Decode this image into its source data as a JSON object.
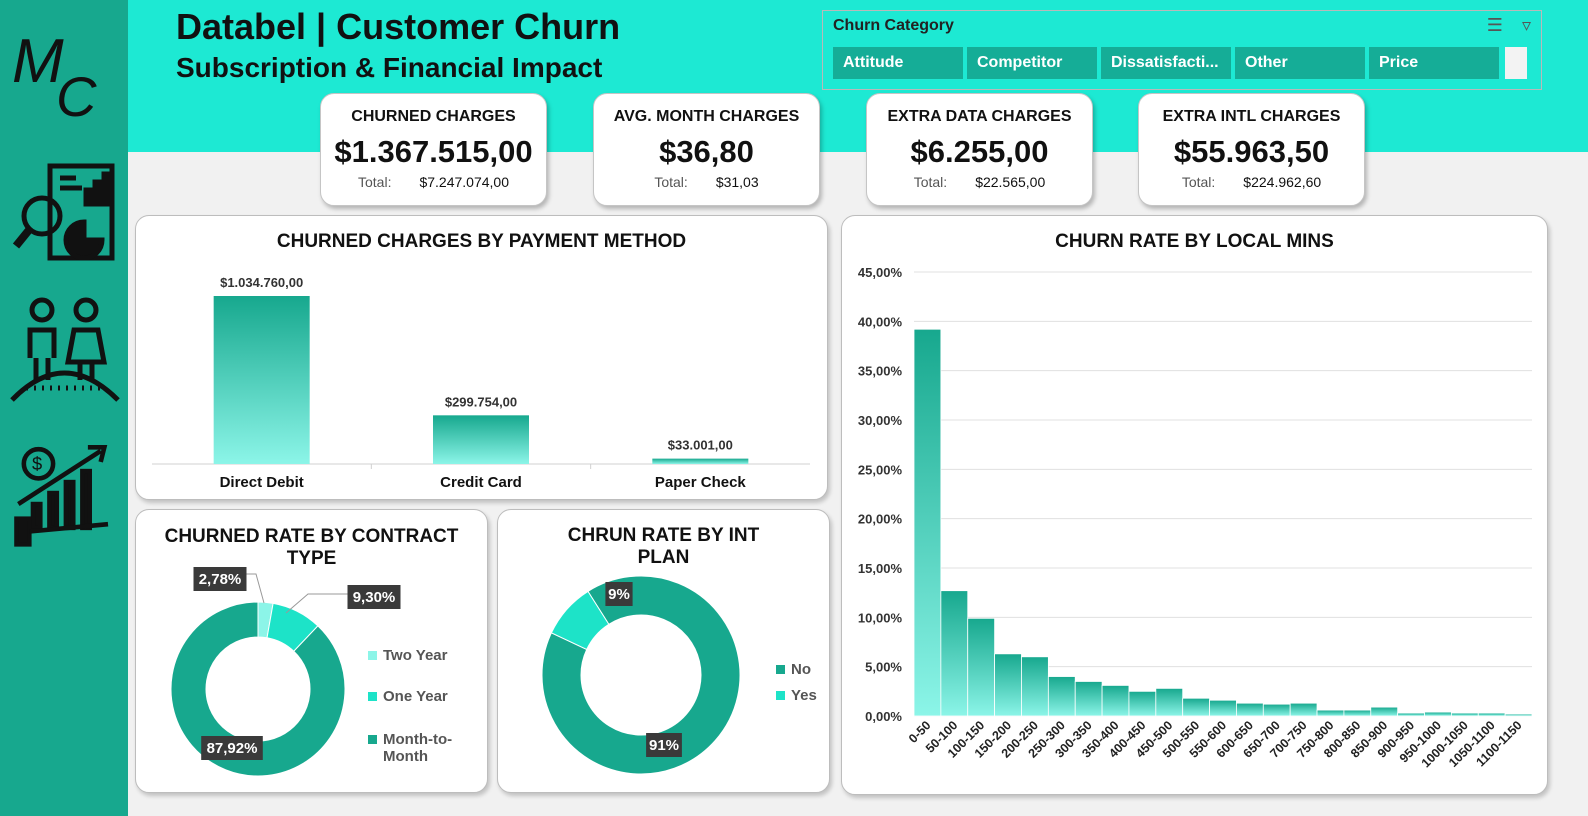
{
  "header": {
    "title": "Databel | Customer Churn",
    "subtitle": "Subscription & Financial Impact",
    "logo_text": "MC"
  },
  "sidebar": {
    "icons": [
      "report-analysis-icon",
      "customers-icon",
      "financial-growth-icon"
    ]
  },
  "slicer": {
    "title": "Churn Category",
    "items": [
      "Attitude",
      "Competitor",
      "Dissatisfacti...",
      "Other",
      "Price"
    ]
  },
  "kpis": [
    {
      "label": "CHURNED CHARGES",
      "value": "$1.367.515,00",
      "total_label": "Total:",
      "total_value": "$7.247.074,00"
    },
    {
      "label": "AVG. MONTH CHARGES",
      "value": "$36,80",
      "total_label": "Total:",
      "total_value": "$31,03"
    },
    {
      "label": "EXTRA DATA CHARGES",
      "value": "$6.255,00",
      "total_label": "Total:",
      "total_value": "$22.565,00"
    },
    {
      "label": "EXTRA INTL CHARGES",
      "value": "$55.963,50",
      "total_label": "Total:",
      "total_value": "$224.962,60"
    }
  ],
  "colors": {
    "accent": "#1de9d3",
    "sidebar": "#17a88e",
    "dark_teal": "#17a88e",
    "mid_teal": "#1de3c8",
    "light_teal": "#8cf5e8"
  },
  "chart_data": [
    {
      "type": "bar",
      "title": "CHURNED CHARGES BY PAYMENT METHOD",
      "categories": [
        "Direct Debit",
        "Credit Card",
        "Paper Check"
      ],
      "values": [
        1034760.0,
        299754.0,
        33001.0
      ],
      "data_labels": [
        "$1.034.760,00",
        "$299.754,00",
        "$33.001,00"
      ]
    },
    {
      "type": "pie",
      "title": "CHURNED RATE BY CONTRACT TYPE",
      "categories": [
        "Two Year",
        "One Year",
        "Month-to-Month"
      ],
      "values": [
        2.78,
        9.3,
        87.92
      ],
      "data_labels": [
        "2,78%",
        "9,30%",
        "87,92%"
      ],
      "legend": "right"
    },
    {
      "type": "pie",
      "title": "CHRUN RATE BY INT PLAN",
      "categories": [
        "No",
        "Yes"
      ],
      "values": [
        91,
        9
      ],
      "data_labels": [
        "91%",
        "9%"
      ],
      "legend": "right"
    },
    {
      "type": "bar",
      "title": "CHURN RATE BY LOCAL MINS",
      "categories": [
        "0-50",
        "50-100",
        "100-150",
        "150-200",
        "200-250",
        "250-300",
        "300-350",
        "350-400",
        "400-450",
        "450-500",
        "500-550",
        "550-600",
        "600-650",
        "650-700",
        "700-750",
        "750-800",
        "800-850",
        "850-900",
        "900-950",
        "950-1000",
        "1000-1050",
        "1050-1100",
        "1100-1150"
      ],
      "values": [
        39.2,
        12.7,
        9.9,
        6.3,
        6.0,
        4.0,
        3.5,
        3.1,
        2.5,
        2.8,
        1.8,
        1.6,
        1.3,
        1.2,
        1.3,
        0.6,
        0.6,
        0.9,
        0.3,
        0.4,
        0.3,
        0.3,
        0.2
      ],
      "ylim": [
        0,
        45
      ],
      "y_ticks": [
        "0,00%",
        "5,00%",
        "10,00%",
        "15,00%",
        "20,00%",
        "25,00%",
        "30,00%",
        "35,00%",
        "40,00%",
        "45,00%"
      ],
      "grid": true
    }
  ]
}
